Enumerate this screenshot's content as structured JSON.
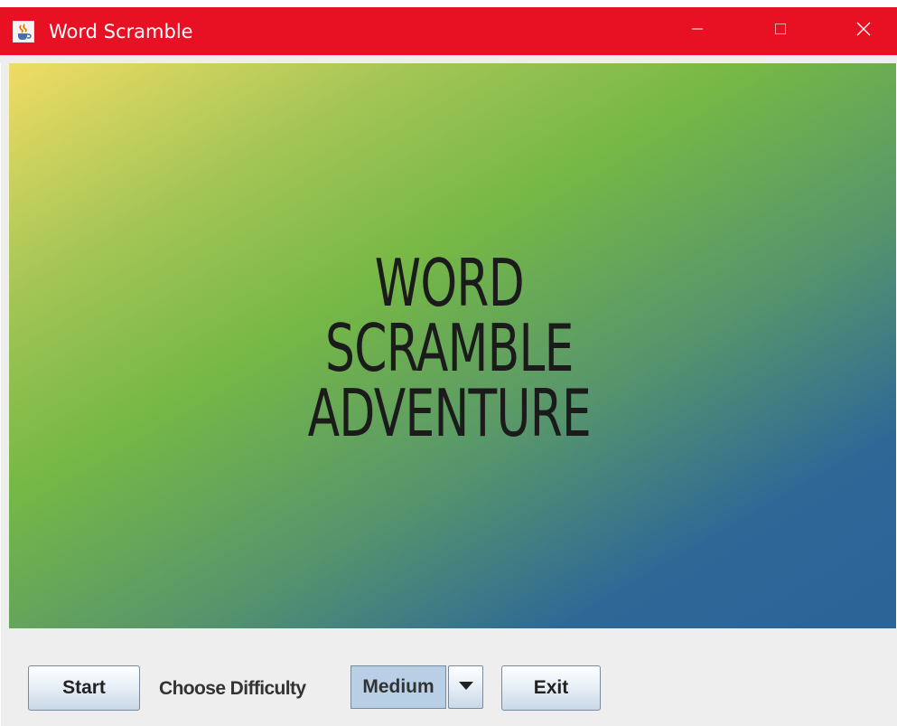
{
  "window": {
    "title": "Word Scramble",
    "title_bar_color": "#e81123",
    "icons": {
      "app": "java-cup-icon",
      "minimize": "minimize-icon",
      "maximize": "maximize-icon",
      "close": "close-icon"
    }
  },
  "banner": {
    "title_lines": [
      "WORD",
      "SCRAMBLE",
      "ADVENTURE"
    ],
    "gradient_colors": [
      "#f0dc64",
      "#76b845",
      "#2c6398"
    ]
  },
  "controls": {
    "start_label": "Start",
    "difficulty_label": "Choose Difficulty",
    "difficulty_selected": "Medium",
    "exit_label": "Exit",
    "dropdown_icon": "caret-down-icon"
  }
}
